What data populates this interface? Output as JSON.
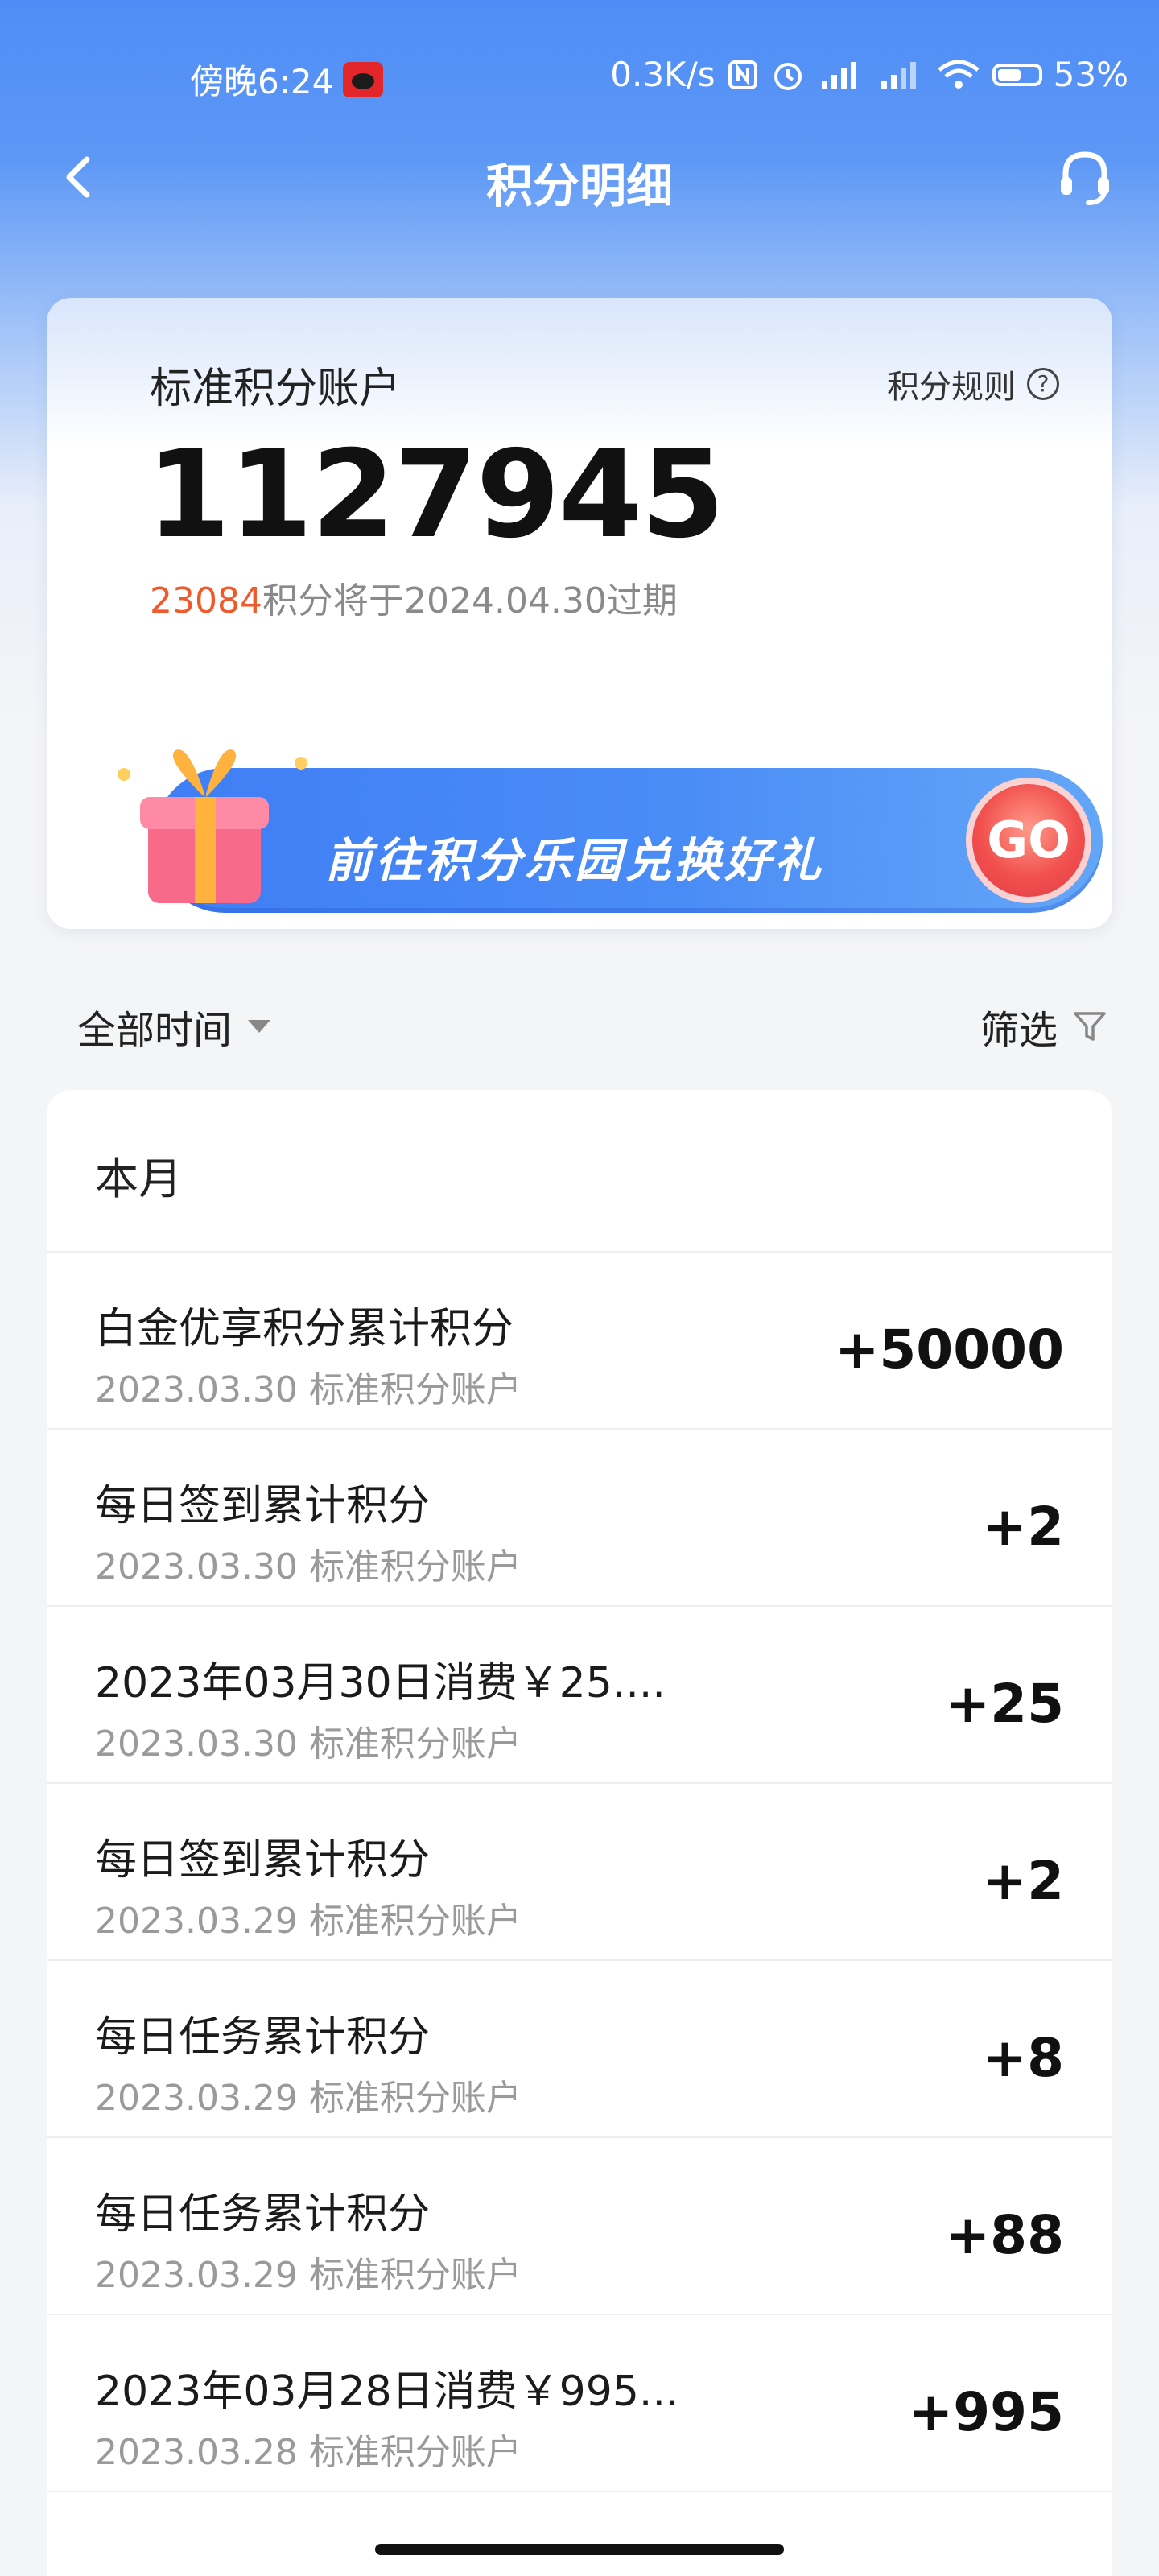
{
  "status_bar": {
    "time": "傍晚6:24",
    "net_speed": "0.3K/s",
    "battery": "53%"
  },
  "nav": {
    "title": "积分明细",
    "back_icon": "chevron-left-icon",
    "service_icon": "headset-icon"
  },
  "account": {
    "title": "标准积分账户",
    "rules_label": "积分规则",
    "total_points": "1127945",
    "expiring_amount": "23084",
    "expiring_text": "积分将于2024.04.30过期"
  },
  "promo": {
    "text": "前往积分乐园兑换好礼",
    "go_label": "GO",
    "gift_icon": "gift-box-icon"
  },
  "filters": {
    "time_label": "全部时间",
    "filter_label": "筛选"
  },
  "records": {
    "month_label": "本月",
    "items": [
      {
        "title": "白金优享积分累计积分",
        "date": "2023.03.30",
        "account": "标准积分账户",
        "amount": "+50000"
      },
      {
        "title": "每日签到累计积分",
        "date": "2023.03.30",
        "account": "标准积分账户",
        "amount": "+2"
      },
      {
        "title": "2023年03月30日消费￥25....",
        "date": "2023.03.30",
        "account": "标准积分账户",
        "amount": "+25"
      },
      {
        "title": "每日签到累计积分",
        "date": "2023.03.29",
        "account": "标准积分账户",
        "amount": "+2"
      },
      {
        "title": "每日任务累计积分",
        "date": "2023.03.29",
        "account": "标准积分账户",
        "amount": "+8"
      },
      {
        "title": "每日任务累计积分",
        "date": "2023.03.29",
        "account": "标准积分账户",
        "amount": "+88"
      },
      {
        "title": "2023年03月28日消费￥995...",
        "date": "2023.03.28",
        "account": "标准积分账户",
        "amount": "+995"
      }
    ]
  },
  "colors": {
    "header_blue": "#4f8df6",
    "expire_orange": "#f05a2a",
    "go_red": "#f1504e"
  }
}
